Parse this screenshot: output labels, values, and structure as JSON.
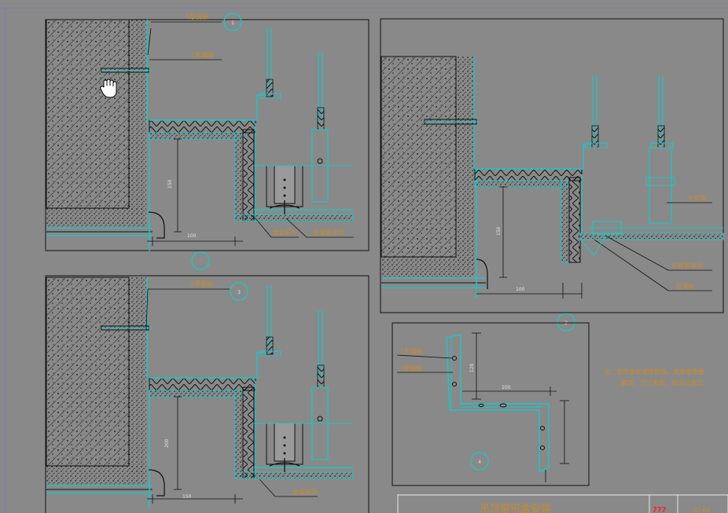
{
  "drawing": {
    "callouts": {
      "detail1_top": "1厚钢板",
      "detail1_mid": "L形钢板",
      "detail1_b1": "龙骨吊件",
      "detail1_b2": "石膏板吊顶",
      "detail2_r1": "主龙骨",
      "detail2_r2": "石膏板吊顶",
      "detail2_r3": "石膏板",
      "detail3_top": "1厚钢板",
      "detail3_b1": "龙骨吊件",
      "detail4_l1": "L形钢板",
      "detail4_l2": "3厚钢板"
    },
    "circle_marks": {
      "c1": "1",
      "c2": "2",
      "c3": "3",
      "c4": "4"
    },
    "note": {
      "line1": "注：窗帘盒长度按现场，宽度按需要",
      "line2": "确定，尺寸参数，按设计施工。"
    },
    "dimensions": {
      "d1": "150",
      "d2": "100",
      "d3": "200",
      "d4": "150",
      "d5": "150",
      "d6": "100",
      "d7": "120",
      "d8": "100"
    },
    "title_block": {
      "title": "吊顶窗帘盒安装",
      "code": "???",
      "sheet": "JD-00"
    }
  },
  "colors": {
    "background": "#898989",
    "cyan": "#18c8c8",
    "line": "#111111",
    "annotation": "#c98b2a",
    "red": "#ff2020"
  },
  "icons": {
    "cursor": "hand-cursor-icon"
  }
}
